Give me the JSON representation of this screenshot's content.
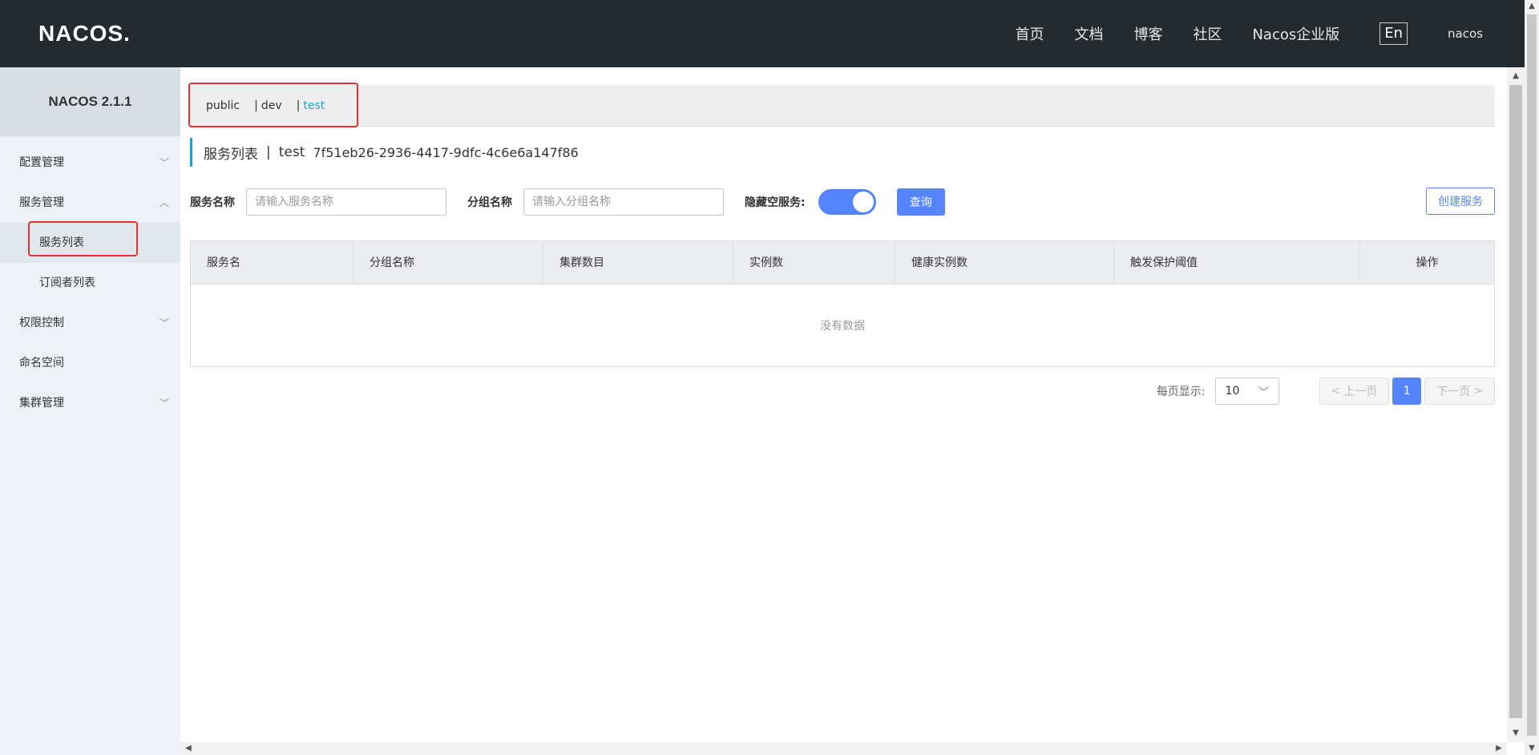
{
  "header": {
    "logo": "NACOS.",
    "nav": [
      "首页",
      "文档",
      "博客",
      "社区",
      "Nacos企业版"
    ],
    "lang": "En",
    "user": "nacos"
  },
  "sidebar": {
    "brand": "NACOS 2.1.1",
    "items": [
      {
        "label": "配置管理"
      },
      {
        "label": "服务管理"
      },
      {
        "label": "服务列表"
      },
      {
        "label": "订阅者列表"
      },
      {
        "label": "权限控制"
      },
      {
        "label": "命名空间"
      },
      {
        "label": "集群管理"
      }
    ]
  },
  "namespaces": {
    "items": [
      "public",
      "dev",
      "test"
    ],
    "separator": "|",
    "active": "test"
  },
  "page": {
    "title": "服务列表",
    "separator": "|",
    "namespace_name": "test",
    "namespace_id": "7f51eb26-2936-4417-9dfc-4c6e6a147f86"
  },
  "filters": {
    "service_name_label": "服务名称",
    "service_name_placeholder": "请输入服务名称",
    "group_name_label": "分组名称",
    "group_name_placeholder": "请输入分组名称",
    "hide_empty_label": "隐藏空服务:",
    "hide_empty_on": true,
    "query_button": "查询",
    "create_button": "创建服务"
  },
  "table": {
    "columns": [
      "服务名",
      "分组名称",
      "集群数目",
      "实例数",
      "健康实例数",
      "触发保护阈值",
      "操作"
    ],
    "empty_text": "没有数据"
  },
  "pagination": {
    "per_page_label": "每页显示:",
    "per_page_value": "10",
    "prev": "上一页",
    "current_page": "1",
    "next": "下一页"
  },
  "colors": {
    "accent": "#5584ff",
    "header_bg": "#252a2f",
    "active_link": "#1ea1d9",
    "highlight_box": "#e8302f"
  }
}
